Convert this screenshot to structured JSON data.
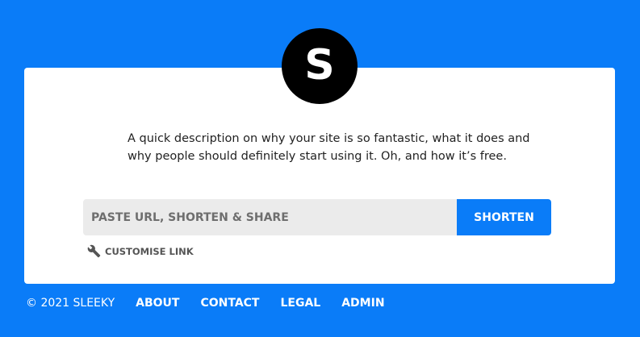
{
  "logo": {
    "letter": "S"
  },
  "description": "A quick description on why your site is so fantastic, what it does and why people should definitely start using it. Oh, and how it’s free.",
  "form": {
    "placeholder": "PASTE URL, SHORTEN & SHARE",
    "value": "",
    "submit_label": "SHORTEN"
  },
  "customise": {
    "icon": "wrench-icon",
    "label": "CUSTOMISE LINK"
  },
  "footer": {
    "copyright": "© 2021 SLEEKY",
    "links": [
      {
        "label": "ABOUT"
      },
      {
        "label": "CONTACT"
      },
      {
        "label": "LEGAL"
      },
      {
        "label": "ADMIN"
      }
    ]
  },
  "colors": {
    "brand_blue": "#0a7cf8",
    "card_bg": "#ffffff",
    "input_bg": "#ebebeb",
    "logo_bg": "#000000"
  }
}
